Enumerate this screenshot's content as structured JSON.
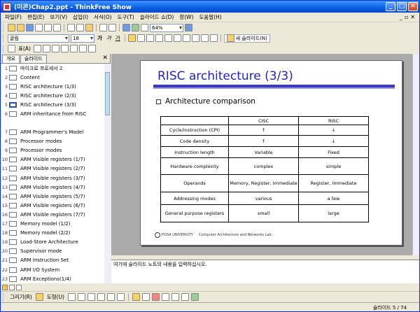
{
  "window": {
    "title": "(미콘)Chap2.ppt - ThinkFree Show",
    "minimize": "_",
    "maximize": "□",
    "close": "✕"
  },
  "menu": [
    "파일(F)",
    "편집(E)",
    "보기(V)",
    "삽입(I)",
    "서식(O)",
    "도구(T)",
    "슬라이드 쇼(D)",
    "창(W)",
    "도움말(H)"
  ],
  "mdi": {
    "minimize": "_",
    "restore": "▫",
    "close": "✕"
  },
  "toolbar": {
    "zoom": "64%",
    "new_slide": "새 슬라이드(N)"
  },
  "format_bar": {
    "font": "굴림",
    "size": "18",
    "bold": "가",
    "italic": "가",
    "underline": "가"
  },
  "table_bar": {
    "label": "표(A)"
  },
  "panel": {
    "tabs": [
      "개요",
      "슬라이드"
    ],
    "close": "✕",
    "items": [
      {
        "num": "1",
        "text": "마이크로 프로세서 2"
      },
      {
        "num": "2",
        "text": "Content"
      },
      {
        "num": "3",
        "text": "RISC architecture (1/3)"
      },
      {
        "num": "4",
        "text": "RISC architecture (2/3)"
      },
      {
        "num": "5",
        "text": "RISC architecture (3/3)"
      },
      {
        "num": "6",
        "text": "ARM inheritance from RISC"
      },
      {
        "num": "7",
        "text": "ARM Programmer's Model"
      },
      {
        "num": "8",
        "text": "Processor modes"
      },
      {
        "num": "9",
        "text": "Processor modes"
      },
      {
        "num": "10",
        "text": "ARM Visible registers (1/7)"
      },
      {
        "num": "11",
        "text": "ARM Visible registers (2/7)"
      },
      {
        "num": "12",
        "text": "ARM Visible registers (3/7)"
      },
      {
        "num": "13",
        "text": "ARM Visible registers (4/7)"
      },
      {
        "num": "14",
        "text": "ARM Visible registers (5/7)"
      },
      {
        "num": "15",
        "text": "ARM Visible registers (6/7)"
      },
      {
        "num": "16",
        "text": "ARM Visible registers (7/7)"
      },
      {
        "num": "17",
        "text": "Memory model (1/2)"
      },
      {
        "num": "18",
        "text": "Memory model (2/2)"
      },
      {
        "num": "19",
        "text": "Load-Store Architecture"
      },
      {
        "num": "20",
        "text": "Supervisor mode"
      },
      {
        "num": "21",
        "text": "ARM Instruction Set"
      },
      {
        "num": "22",
        "text": "ARM I/O System"
      },
      {
        "num": "23",
        "text": "ARM Exceptions(1/4)"
      }
    ]
  },
  "slide": {
    "title": "RISC architecture (3/3)",
    "bullet": "Architecture comparison",
    "table": {
      "header": [
        "",
        "CISC",
        "RISC"
      ],
      "rows": [
        [
          "Cycle/instruction (CPI)",
          "↑",
          "↓"
        ],
        [
          "Code density",
          "↑",
          "↓"
        ],
        [
          "Instruction length",
          "Variable",
          "Fixed"
        ],
        [
          "Hardware complexity",
          "complex",
          "simple"
        ],
        [
          "Operands",
          "Memory, Register, Immediate",
          "Register, Immediate"
        ],
        [
          "Addressing modes",
          "various",
          "a few"
        ],
        [
          "General purpose registers",
          "small",
          "large"
        ]
      ]
    },
    "footer_logo": "POSA UNIVERSITY",
    "footer_text": "Computer Architecture and Networks Lab."
  },
  "notes": {
    "placeholder": "여기에 슬라이드 노트의 내용을 입력하십시오."
  },
  "draw": {
    "draw_label": "그리기(R)",
    "shapes_label": "도형(U)"
  },
  "status": {
    "slide": "슬라이드 5 / 74"
  }
}
